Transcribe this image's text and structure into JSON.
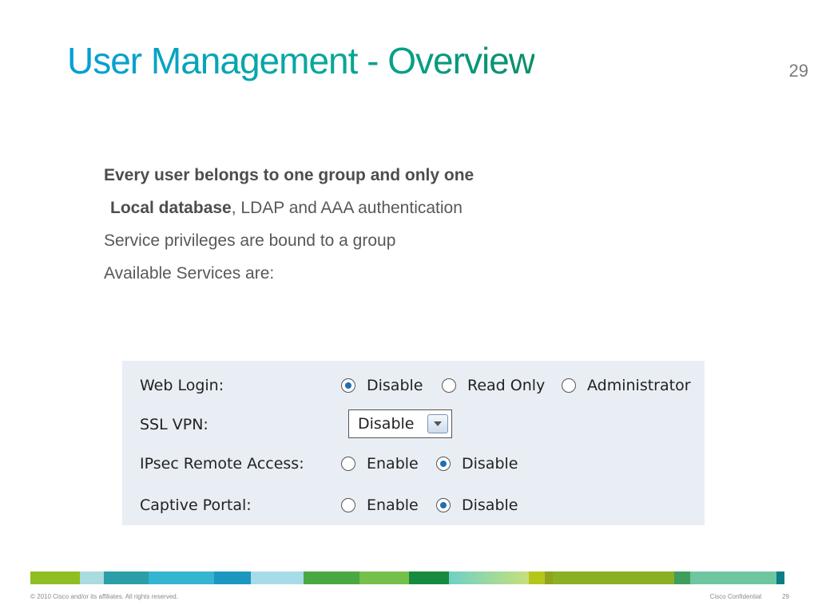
{
  "slide": {
    "title": "User Management - Overview",
    "page_number": "29"
  },
  "bullets": {
    "b1": "Every user belongs to one group and only one",
    "b2_bold": "Local database",
    "b2_rest": ", LDAP and AAA authentication",
    "b3": "Service privileges are bound to a group",
    "b4": "Available Services are:"
  },
  "services": {
    "web_login": {
      "label": "Web Login:",
      "options": [
        "Disable",
        "Read Only",
        "Administrator"
      ],
      "selected": "Disable"
    },
    "ssl_vpn": {
      "label": "SSL VPN:",
      "value": "Disable"
    },
    "ipsec": {
      "label": "IPsec Remote Access:",
      "options": [
        "Enable",
        "Disable"
      ],
      "selected": "Disable"
    },
    "captive": {
      "label": "Captive Portal:",
      "options": [
        "Enable",
        "Disable"
      ],
      "selected": "Disable"
    }
  },
  "footer": {
    "copyright": "© 2010 Cisco and/or its affiliates. All rights reserved.",
    "confidential": "Cisco Confidential",
    "page": "29"
  },
  "colors": {
    "title_start": "#049fd9",
    "title_end": "#0a8f6a",
    "panel_bg": "#e8eef4",
    "radio_dot": "#1e6fb0"
  }
}
